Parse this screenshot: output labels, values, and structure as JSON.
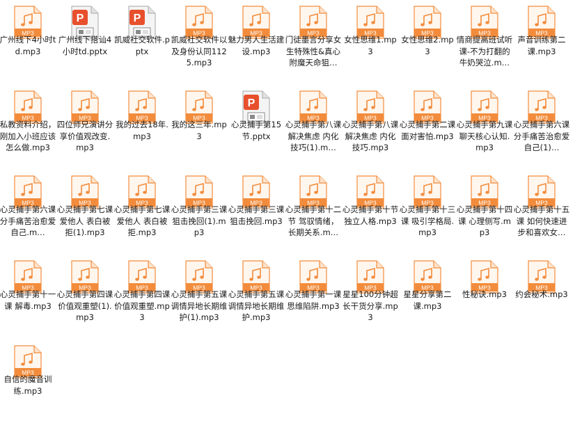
{
  "files": [
    {
      "name": "广州线下4小时td.mp3",
      "type": "mp3"
    },
    {
      "name": "广州线下搭讪4小时td.pptx",
      "type": "pptx"
    },
    {
      "name": "凯威社交软件.pptx",
      "type": "pptx"
    },
    {
      "name": "凯威社交软件以及身份认同1125.mp3",
      "type": "mp3"
    },
    {
      "name": "魅力男人生活建设.mp3",
      "type": "mp3"
    },
    {
      "name": "门徒墨言分享女生特殊性&真心附魔天命狙…",
      "type": "mp3"
    },
    {
      "name": "女性思维1.mp3",
      "type": "mp3"
    },
    {
      "name": "女性思维2.mp3",
      "type": "mp3"
    },
    {
      "name": "情商提高班试听课-不为打翻的牛奶哭泣.m…",
      "type": "mp3"
    },
    {
      "name": "声音训练第二课.mp3",
      "type": "mp3"
    },
    {
      "name": "私教资料介绍，刚加入小班应该怎么做.mp3",
      "type": "mp3"
    },
    {
      "name": "四位师兄演讲分享价值观改变.mp3",
      "type": "mp3"
    },
    {
      "name": "我的过去18年.mp3",
      "type": "mp3"
    },
    {
      "name": "我的这三年.mp3",
      "type": "mp3"
    },
    {
      "name": "心灵捕手第15节.pptx",
      "type": "pptx"
    },
    {
      "name": "心灵捕手第八课 解决焦虑 内化技巧(1).m…",
      "type": "mp3"
    },
    {
      "name": "心灵捕手第八课 解决焦虑 内化技巧.mp3",
      "type": "mp3"
    },
    {
      "name": "心灵捕手第二课 面对害怕.mp3",
      "type": "mp3"
    },
    {
      "name": "心灵捕手第九课 聊天核心认知.mp3",
      "type": "mp3"
    },
    {
      "name": "心灵捕手第六课 分手痛苦治愈爱自己(1)…",
      "type": "mp3"
    },
    {
      "name": "心灵捕手第六课 分手痛苦治愈爱自己.m…",
      "type": "mp3"
    },
    {
      "name": "心灵捕手第七课 爱他人 表白被拒(1).mp3",
      "type": "mp3"
    },
    {
      "name": "心灵捕手第七课 爱他人 表白被拒.mp3",
      "type": "mp3"
    },
    {
      "name": "心灵捕手第三课 狙击挽回(1).mp3",
      "type": "mp3"
    },
    {
      "name": "心灵捕手第三课 狙击挽回.mp3",
      "type": "mp3"
    },
    {
      "name": "心灵捕手第十二节 驾驭情绪，长期关系.m…",
      "type": "mp3"
    },
    {
      "name": "心灵捕手第十节 独立人格.mp3",
      "type": "mp3"
    },
    {
      "name": "心灵捕手第十三课 吸引学格局.mp3",
      "type": "mp3"
    },
    {
      "name": "心灵捕手第十四课 心理侧写.mp3",
      "type": "mp3"
    },
    {
      "name": "心灵捕手第十五课 如何快速进步和喜欢女…",
      "type": "mp3"
    },
    {
      "name": "心灵捕手第十一课 解毒.mp3",
      "type": "mp3"
    },
    {
      "name": "心灵捕手第四课 价值观重塑(1).mp3",
      "type": "mp3"
    },
    {
      "name": "心灵捕手第四课 价值观重塑.mp3",
      "type": "mp3"
    },
    {
      "name": "心灵捕手第五课 调情异地长期维护(1).mp3",
      "type": "mp3"
    },
    {
      "name": "心灵捕手第五课 调情异地长期维护.mp3",
      "type": "mp3"
    },
    {
      "name": "心灵捕手第一课 思维陷阱.mp3",
      "type": "mp3"
    },
    {
      "name": "星星100分钟超长干货分享.mp3",
      "type": "mp3"
    },
    {
      "name": "星星分享第二课.mp3",
      "type": "mp3"
    },
    {
      "name": "性秘诀.mp3",
      "type": "mp3"
    },
    {
      "name": "约会秘术.mp3",
      "type": "mp3"
    },
    {
      "name": "自信的魔音训练.mp3",
      "type": "mp3"
    }
  ],
  "mp3_badge": "MP3",
  "pptx_badge": "P",
  "colors": {
    "mp3_accent": "#f28c3c",
    "mp3_page": "#fff6ee",
    "pptx_accent": "#e8502d",
    "pptx_page": "#f4f4f4",
    "text": "#1a1a1a"
  }
}
